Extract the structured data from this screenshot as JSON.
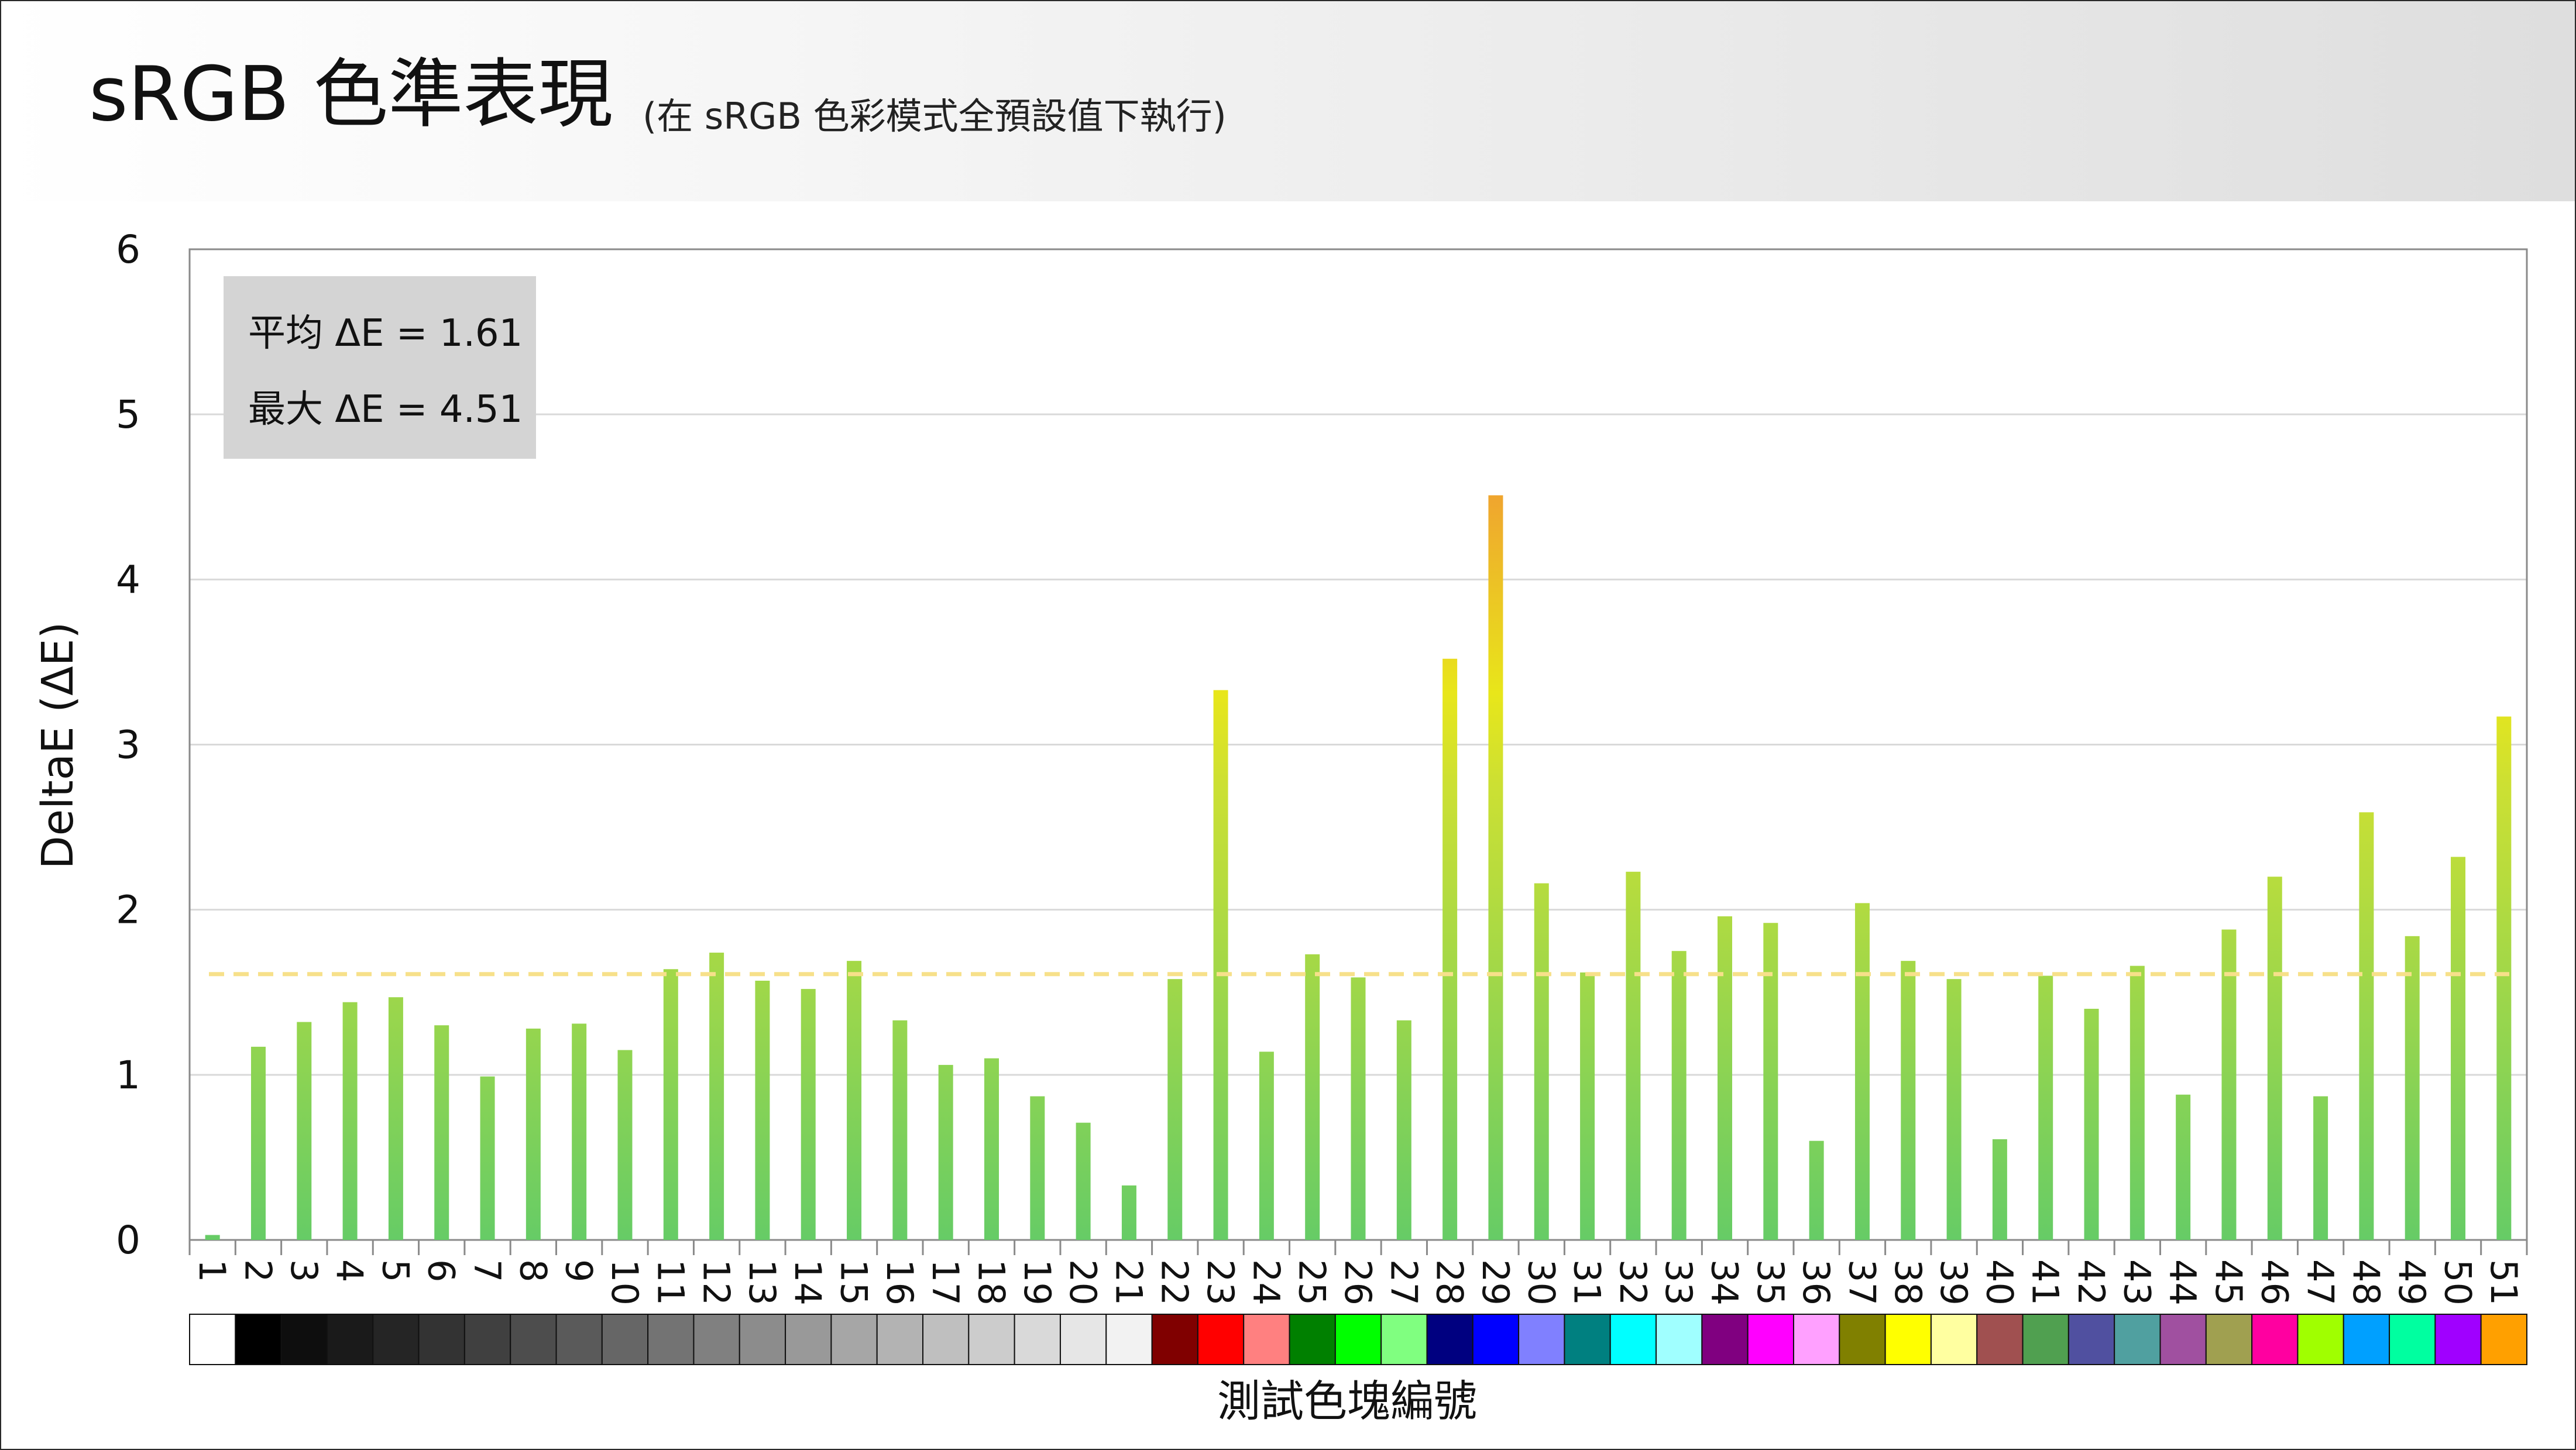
{
  "title": "sRGB 色準表現",
  "subtitle": "(在 sRGB 色彩模式全預設值下執行)",
  "stats": {
    "avg": "平均 ΔE = 1.61",
    "max": "最大 ΔE = 4.51"
  },
  "chart_data": {
    "type": "bar",
    "title": "sRGB 色準表現",
    "xlabel": "測試色塊編號",
    "ylabel": "DeltaE (ΔE)",
    "ylim": [
      0,
      6
    ],
    "yticks": [
      0,
      1,
      2,
      3,
      4,
      5,
      6
    ],
    "grid": true,
    "categories": [
      "1",
      "2",
      "3",
      "4",
      "5",
      "6",
      "7",
      "8",
      "9",
      "10",
      "11",
      "12",
      "13",
      "14",
      "15",
      "16",
      "17",
      "18",
      "19",
      "20",
      "21",
      "22",
      "23",
      "24",
      "25",
      "26",
      "27",
      "28",
      "29",
      "30",
      "31",
      "32",
      "33",
      "34",
      "35",
      "36",
      "37",
      "38",
      "39",
      "40",
      "41",
      "42",
      "43",
      "44",
      "45",
      "46",
      "47",
      "48",
      "49",
      "50",
      "51"
    ],
    "values": [
      0.03,
      1.17,
      1.32,
      1.44,
      1.47,
      1.3,
      0.99,
      1.28,
      1.31,
      1.15,
      1.64,
      1.74,
      1.57,
      1.52,
      1.69,
      1.33,
      1.06,
      1.1,
      0.87,
      0.71,
      0.33,
      1.58,
      3.33,
      1.14,
      1.73,
      1.59,
      1.33,
      3.52,
      4.51,
      2.16,
      1.62,
      2.23,
      1.75,
      1.96,
      1.92,
      0.6,
      2.04,
      1.69,
      1.58,
      0.61,
      1.6,
      1.4,
      1.66,
      0.88,
      1.88,
      2.2,
      0.87,
      2.59,
      1.84,
      2.32,
      3.17
    ],
    "average": 1.61,
    "average_line": "dashed",
    "patch_colors": [
      "#ffffff",
      "#000000",
      "#0e0e0e",
      "#1a1a1a",
      "#252525",
      "#333333",
      "#404040",
      "#4d4d4d",
      "#5a5a5a",
      "#666666",
      "#737373",
      "#808080",
      "#8c8c8c",
      "#999999",
      "#a6a6a6",
      "#b3b3b3",
      "#bfbfbf",
      "#cccccc",
      "#d9d9d9",
      "#e6e6e6",
      "#f2f2f2",
      "#800000",
      "#ff0000",
      "#ff8080",
      "#008000",
      "#00ff00",
      "#80ff80",
      "#000080",
      "#0000ff",
      "#8080ff",
      "#008080",
      "#00ffff",
      "#a0ffff",
      "#800080",
      "#ff00ff",
      "#ffa0ff",
      "#808000",
      "#ffff00",
      "#ffffa0",
      "#a05050",
      "#50a050",
      "#5050a0",
      "#50a0a0",
      "#a050a0",
      "#a0a050",
      "#ff00a0",
      "#a0ff00",
      "#00a0ff",
      "#00ffa0",
      "#a000ff",
      "#ffa000"
    ]
  },
  "colors": {
    "bar_low": "#66cc66",
    "bar_mid": "#cce033",
    "bar_high": "#f0a030",
    "average_line": "#f7e08a",
    "stats_box": "#d4d4d4",
    "grid": "#d9d9d9"
  }
}
